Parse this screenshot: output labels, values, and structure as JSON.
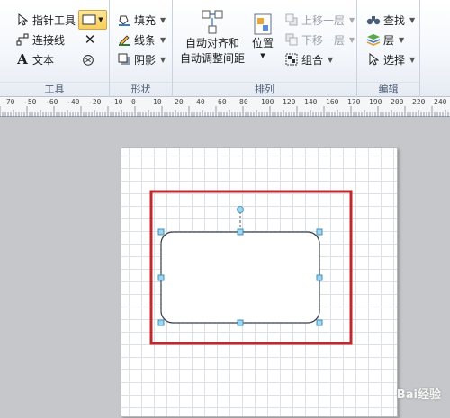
{
  "ribbon": {
    "tools": {
      "pointer_label": "指针工具",
      "connector_label": "连接线",
      "text_label": "文本",
      "group_label": "工具"
    },
    "shape": {
      "fill_label": "填充",
      "line_label": "线条",
      "shadow_label": "阴影",
      "group_label": "形状"
    },
    "arrange": {
      "autoalign_label": "自动对齐和\n自动调整间距",
      "position_label": "位置",
      "bring_forward_label": "上移一层",
      "send_backward_label": "下移一层",
      "group_cmd_label": "组合",
      "group_label": "排列"
    },
    "edit": {
      "find_label": "查找",
      "layers_label": "层",
      "select_label": "选择",
      "group_label": "编辑"
    }
  },
  "ruler": {
    "labels": [
      "-70",
      "-50",
      "-60",
      "-40",
      "-20",
      "-10",
      "0",
      "10",
      "20",
      "40",
      "60",
      "80",
      "100",
      "120",
      "140",
      "160",
      "170",
      "190",
      "200",
      "220",
      "240"
    ]
  },
  "watermark": "Bai经验",
  "colors": {
    "highlight_box": "#c0282d",
    "handle": "#5fb6dc",
    "active_button": "#f8cd5b"
  }
}
